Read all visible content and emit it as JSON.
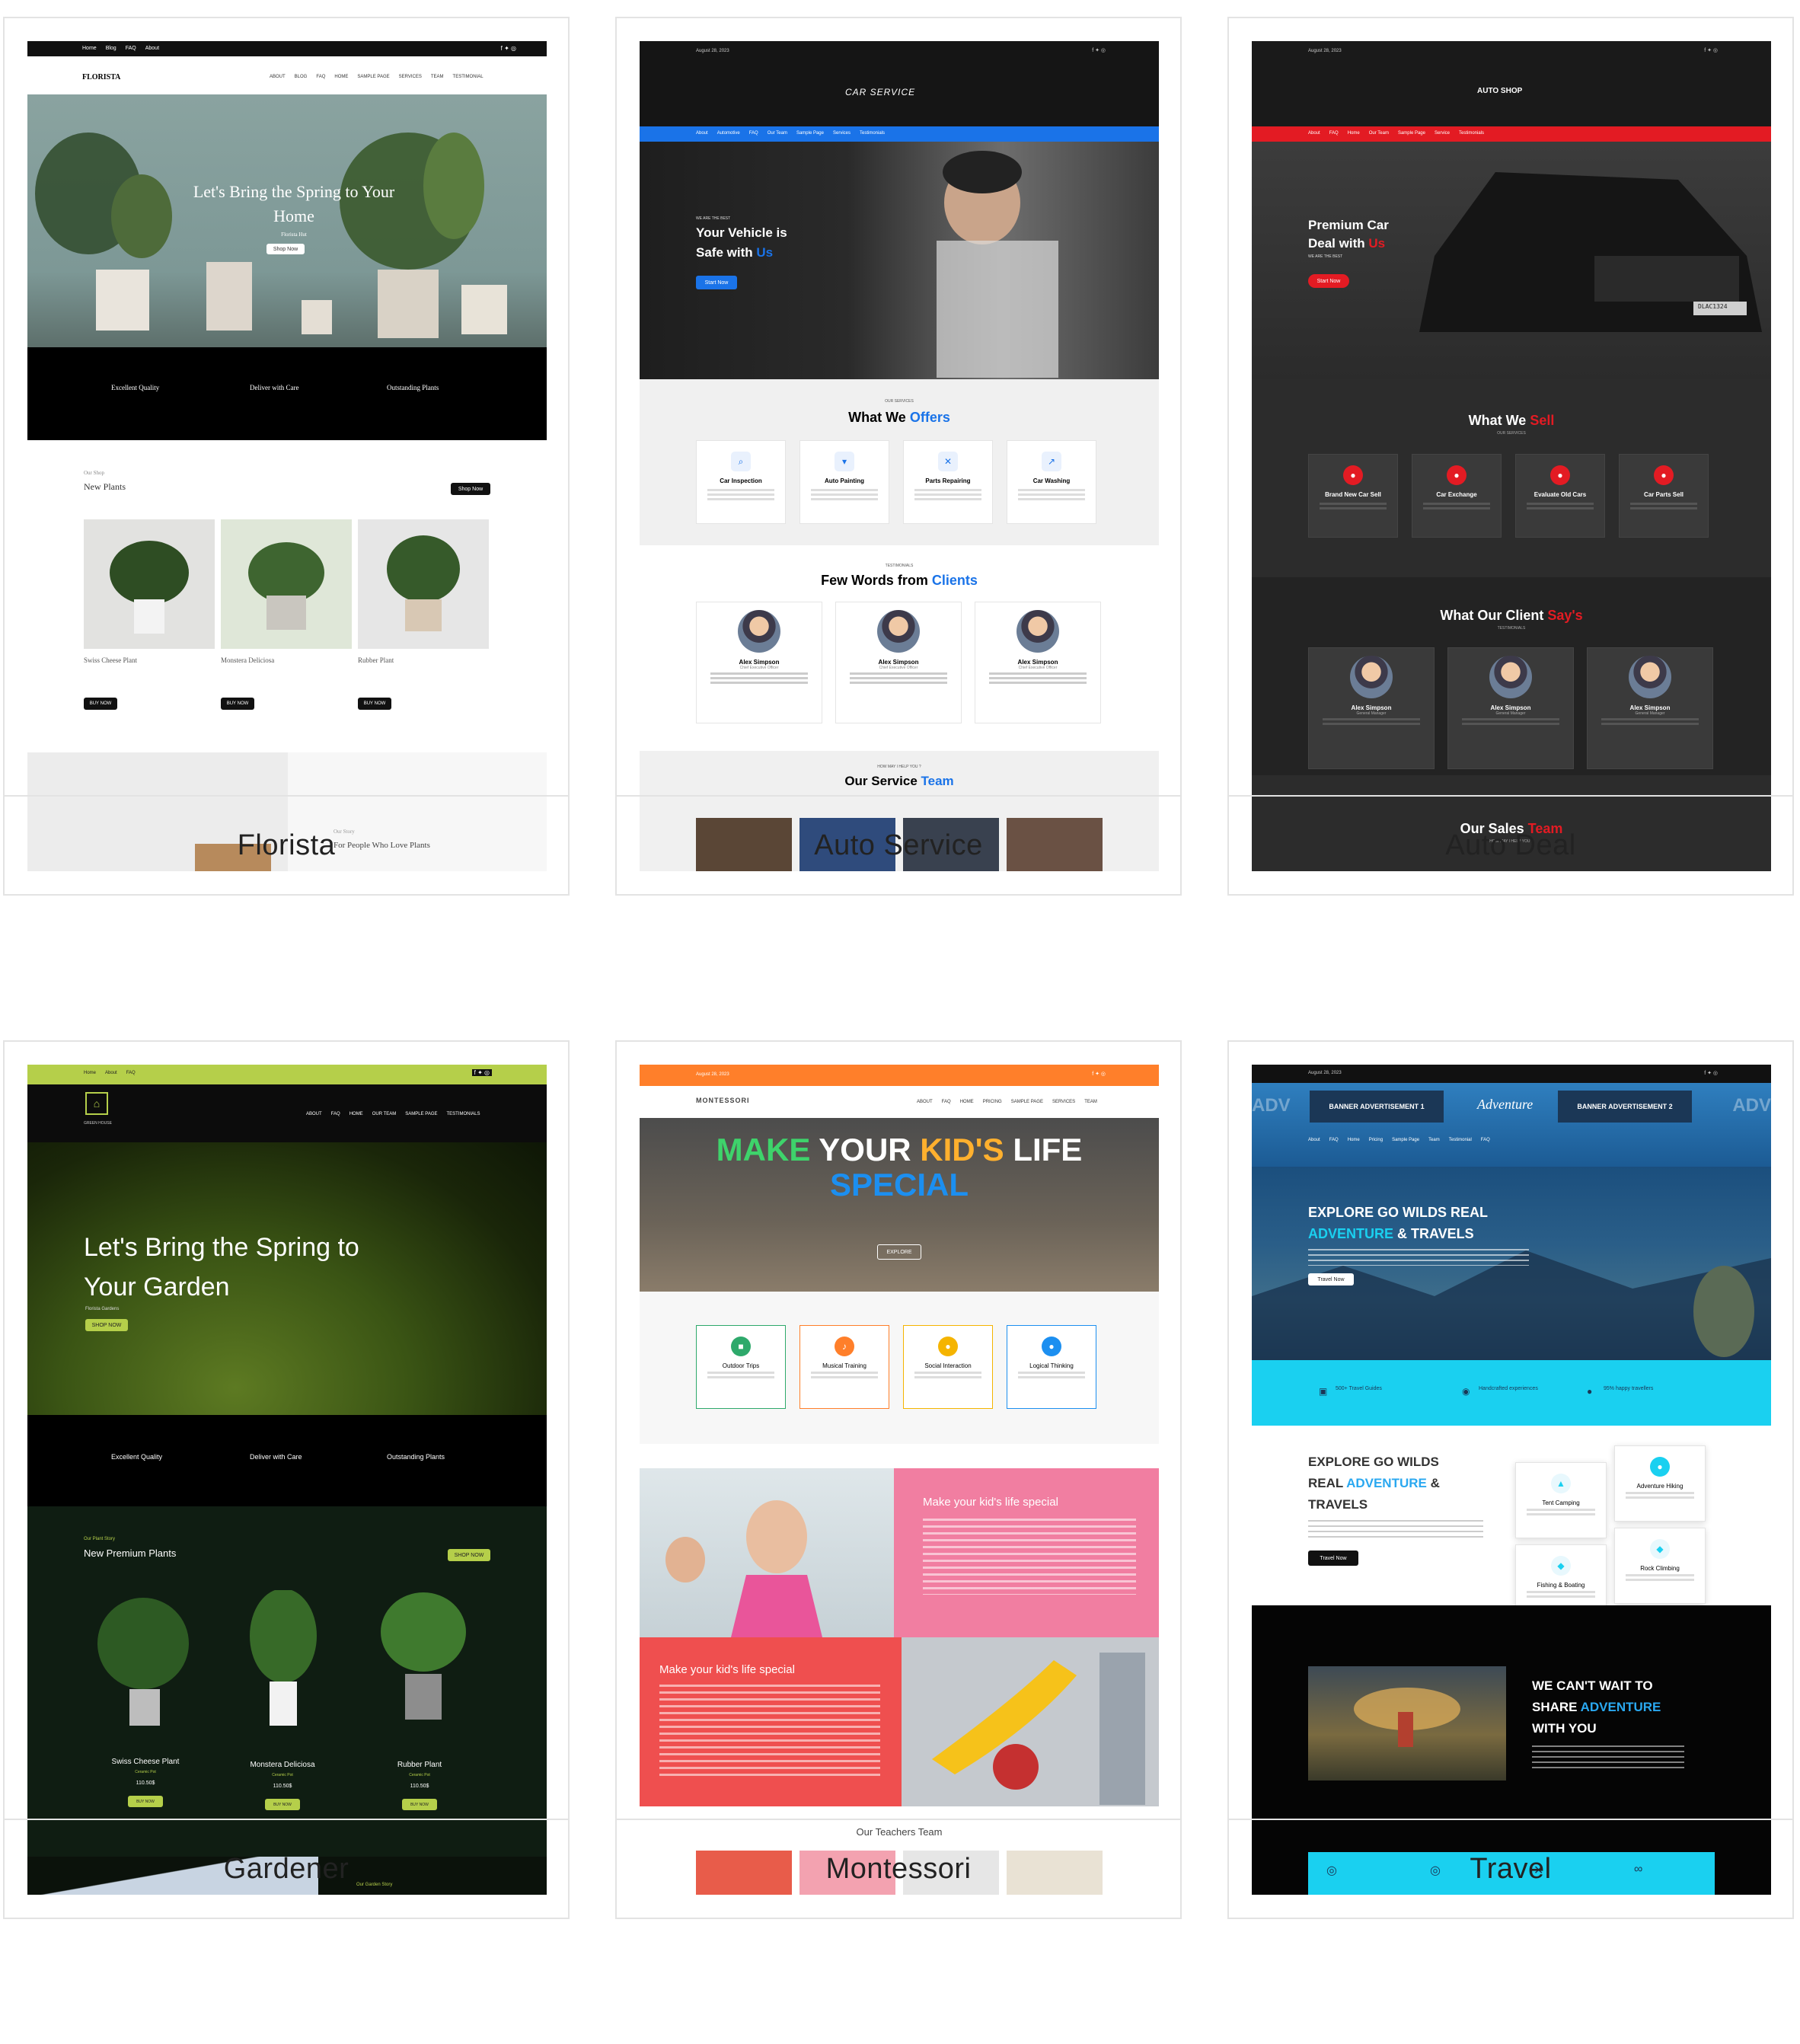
{
  "cards": [
    {
      "caption": "Florista",
      "topbar": {
        "links": [
          "Home",
          "Blog",
          "FAQ",
          "About"
        ]
      },
      "logo": "FLORISTA",
      "nav": [
        "ABOUT",
        "BLOG",
        "FAQ",
        "HOME",
        "SAMPLE PAGE",
        "SERVICES",
        "TEAM",
        "TESTIMONIAL"
      ],
      "hero": {
        "title": "Let's Bring the Spring to Your Home",
        "subtitle": "Florista Hut",
        "button": "Shop Now"
      },
      "features": [
        "Excellent Quality",
        "Deliver with Care",
        "Outstanding Plants"
      ],
      "shop": {
        "kicker": "Our Shop",
        "title": "New Plants",
        "button": "Shop Now"
      },
      "products": [
        {
          "name": "Swiss Cheese Plant",
          "button": "BUY NOW"
        },
        {
          "name": "Monstera Deliciosa",
          "button": "BUY NOW"
        },
        {
          "name": "Rubber Plant",
          "button": "BUY NOW"
        }
      ],
      "story": {
        "kicker": "Our Story",
        "title": "For People Who Love Plants"
      }
    },
    {
      "caption": "Auto Service",
      "date": "August 28, 2023",
      "logo": "CAR SERVICE",
      "nav": [
        "About",
        "Automotive",
        "FAQ",
        "Our Team",
        "Sample Page",
        "Services",
        "Testimonials"
      ],
      "hero": {
        "kicker": "WE ARE THE BEST",
        "line1": "Your Vehicle is",
        "line2a": "Safe with ",
        "line2b": "Us",
        "button": "Start Now"
      },
      "offers": {
        "kicker": "OUR SERVICES",
        "titleA": "What We ",
        "titleB": "Offers",
        "items": [
          "Car Inspection",
          "Auto Painting",
          "Parts Repairing",
          "Car Washing"
        ]
      },
      "testimonials": {
        "kicker": "TESTIMONIALS",
        "titleA": "Few Words from ",
        "titleB": "Clients",
        "name": "Alex Simpson",
        "role": "Chief Executive Officer"
      },
      "team": {
        "kicker": "HOW MAY I HELP YOU ?",
        "titleA": "Our Service ",
        "titleB": "Team"
      }
    },
    {
      "caption": "Auto Deal",
      "date": "August 28, 2023",
      "logo": "AUTO SHOP",
      "nav": [
        "About",
        "FAQ",
        "Home",
        "Our Team",
        "Sample Page",
        "Service",
        "Testimonials"
      ],
      "hero": {
        "line1": "Premium Car",
        "line2a": "Deal with ",
        "line2b": "Us",
        "kicker": "WE ARE THE BEST",
        "button": "Start Now"
      },
      "plate": "DLAC1324",
      "sell": {
        "titleA": "What We ",
        "titleB": "Sell",
        "kicker": "OUR SERVICES",
        "items": [
          "Brand New Car Sell",
          "Car Exchange",
          "Evaluate Old Cars",
          "Car Parts Sell"
        ]
      },
      "clients": {
        "titleA": "What Our Client ",
        "titleB": "Say's",
        "kicker": "TESTIMONIALS",
        "name": "Alex Simpson",
        "role": "General Manager"
      },
      "team": {
        "titleA": "Our Sales ",
        "titleB": "Team",
        "kicker": "HOW MAY I HELP YOU ?"
      }
    },
    {
      "caption": "Gardener",
      "topbar": {
        "links": [
          "Home",
          "About",
          "FAQ"
        ]
      },
      "logo": "GREEN HOUSE",
      "nav": [
        "ABOUT",
        "FAQ",
        "HOME",
        "OUR TEAM",
        "SAMPLE PAGE",
        "TESTIMONIALS"
      ],
      "hero": {
        "title1": "Let's Bring the Spring to",
        "title2": "Your Garden",
        "subtitle": "Florista Gardens",
        "button": "SHOP NOW"
      },
      "features": [
        "Excellent Quality",
        "Deliver with Care",
        "Outstanding Plants"
      ],
      "shop": {
        "kicker": "Our Plant Story",
        "title": "New Premium Plants",
        "button": "SHOP NOW"
      },
      "products": [
        {
          "name": "Swiss Cheese Plant",
          "sub": "Ceramic Pot",
          "price": "110.50$",
          "button": "BUY NOW"
        },
        {
          "name": "Monstera Deliciosa",
          "sub": "Ceramic Pot",
          "price": "110.50$",
          "button": "BUY NOW"
        },
        {
          "name": "Rubber Plant",
          "sub": "Ceramic Pot",
          "price": "110.50$",
          "button": "BUY NOW"
        }
      ],
      "story": "Our Garden Story"
    },
    {
      "caption": "Montessori",
      "date": "August 28, 2023",
      "logo": "MONTESSORI",
      "nav": [
        "ABOUT",
        "FAQ",
        "HOME",
        "PRICING",
        "SAMPLE PAGE",
        "SERVICES",
        "TEAM"
      ],
      "hero": {
        "w1": "MAKE",
        "w2": "YOUR",
        "w3": "KID'S",
        "w4": "LIFE",
        "w5": "SPECIAL",
        "button": "EXPLORE"
      },
      "features": [
        "Outdoor Trips",
        "Musical Training",
        "Social Interaction",
        "Logical Thinking"
      ],
      "block1": "Make your kid's life special",
      "block2": "Make your kid's life special",
      "teachers": "Our Teachers Team"
    },
    {
      "caption": "Travel",
      "date": "August 28, 2023",
      "banner": [
        "BANNER ADVERTISEMENT 1",
        "Adventure",
        "BANNER ADVERTISEMENT 2",
        "ADV",
        "ADV"
      ],
      "nav": [
        "About",
        "FAQ",
        "Home",
        "Pricing",
        "Sample Page",
        "Team",
        "Testimonial",
        "FAQ"
      ],
      "hero": {
        "line1": "EXPLORE GO WILDS REAL",
        "line2a": "ADVENTURE",
        "line2b": " & TRAVELS",
        "button": "Travel Now"
      },
      "stats": [
        "500+ Travel Guides",
        "Handcrafted experiences",
        "95% happy travellers"
      ],
      "about": {
        "l1": "EXPLORE GO WILDS",
        "l2a": "REAL ",
        "l2b": "ADVENTURE",
        "l2c": " &",
        "l3": "TRAVELS",
        "button": "Travel Now"
      },
      "activities": [
        "Tent Camping",
        "Adventure Hiking",
        "Fishing & Boating",
        "Rock Climbing"
      ],
      "share": {
        "l1": "WE CAN'T WAIT TO",
        "l2a": "SHARE ",
        "l2b": "ADVENTURE",
        "l3": "WITH YOU"
      }
    }
  ],
  "colors": {
    "autoBlue": "#1a73e8",
    "autoRed": "#e31b23",
    "gardenLime": "#b5cf4a",
    "montOrange": "#ff7f2a",
    "travelCyan": "#1ad0f0",
    "travelBlue": "#2aa8f0"
  }
}
